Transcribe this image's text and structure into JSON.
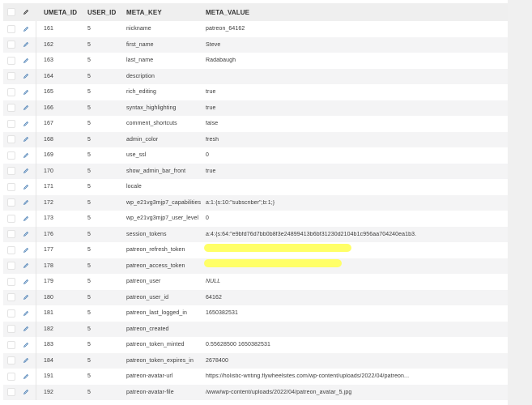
{
  "headers": [
    "UMETA_ID",
    "USER_ID",
    "META_KEY",
    "META_VALUE"
  ],
  "rows": [
    {
      "umeta_id": "161",
      "user_id": "5",
      "meta_key": "nickname",
      "meta_value": "patreon_64162"
    },
    {
      "umeta_id": "162",
      "user_id": "5",
      "meta_key": "first_name",
      "meta_value": "Steve"
    },
    {
      "umeta_id": "163",
      "user_id": "5",
      "meta_key": "last_name",
      "meta_value": "Radabaugh"
    },
    {
      "umeta_id": "164",
      "user_id": "5",
      "meta_key": "description",
      "meta_value": ""
    },
    {
      "umeta_id": "165",
      "user_id": "5",
      "meta_key": "rich_editing",
      "meta_value": "true"
    },
    {
      "umeta_id": "166",
      "user_id": "5",
      "meta_key": "syntax_highlighting",
      "meta_value": "true"
    },
    {
      "umeta_id": "167",
      "user_id": "5",
      "meta_key": "comment_shortcuts",
      "meta_value": "false"
    },
    {
      "umeta_id": "168",
      "user_id": "5",
      "meta_key": "admin_color",
      "meta_value": "fresh"
    },
    {
      "umeta_id": "169",
      "user_id": "5",
      "meta_key": "use_ssl",
      "meta_value": "0"
    },
    {
      "umeta_id": "170",
      "user_id": "5",
      "meta_key": "show_admin_bar_front",
      "meta_value": "true"
    },
    {
      "umeta_id": "171",
      "user_id": "5",
      "meta_key": "locale",
      "meta_value": ""
    },
    {
      "umeta_id": "172",
      "user_id": "5",
      "meta_key": "wp_e21vg3mjp7_capabilities",
      "meta_value": "a:1:{s:10:\"subscriber\";b:1;}"
    },
    {
      "umeta_id": "173",
      "user_id": "5",
      "meta_key": "wp_e21vg3mjp7_user_level",
      "meta_value": "0"
    },
    {
      "umeta_id": "176",
      "user_id": "5",
      "meta_key": "session_tokens",
      "meta_value": "a:4:{s:64:\"e9bfd76d7bb0b8f3e24899413b6bf31230d2104b1c956aa704240ea1b3..."
    },
    {
      "umeta_id": "177",
      "user_id": "5",
      "meta_key": "patreon_refresh_token",
      "meta_value": ""
    },
    {
      "umeta_id": "178",
      "user_id": "5",
      "meta_key": "patreon_access_token",
      "meta_value": ""
    },
    {
      "umeta_id": "179",
      "user_id": "5",
      "meta_key": "patreon_user",
      "meta_value": "NULL"
    },
    {
      "umeta_id": "180",
      "user_id": "5",
      "meta_key": "patreon_user_id",
      "meta_value": "64162"
    },
    {
      "umeta_id": "181",
      "user_id": "5",
      "meta_key": "patreon_last_logged_in",
      "meta_value": "1650382531"
    },
    {
      "umeta_id": "182",
      "user_id": "5",
      "meta_key": "patreon_created",
      "meta_value": ""
    },
    {
      "umeta_id": "183",
      "user_id": "5",
      "meta_key": "patreon_token_minted",
      "meta_value": "0.55628500 1650382531"
    },
    {
      "umeta_id": "184",
      "user_id": "5",
      "meta_key": "patreon_token_expires_in",
      "meta_value": "2678400"
    },
    {
      "umeta_id": "191",
      "user_id": "5",
      "meta_key": "patreon-avatar-url",
      "meta_value": "https://holistic-writing.flywheelsites.com/wp-content/uploads/2022/04/patreon..."
    },
    {
      "umeta_id": "192",
      "user_id": "5",
      "meta_key": "patreon-avatar-file",
      "meta_value": "/www/wp-content/uploads/2022/04/patreon_avatar_5.jpg"
    }
  ],
  "redaction_color": "#ffff5a",
  "icons": {
    "edit": "pencil-icon",
    "select": "checkbox"
  }
}
